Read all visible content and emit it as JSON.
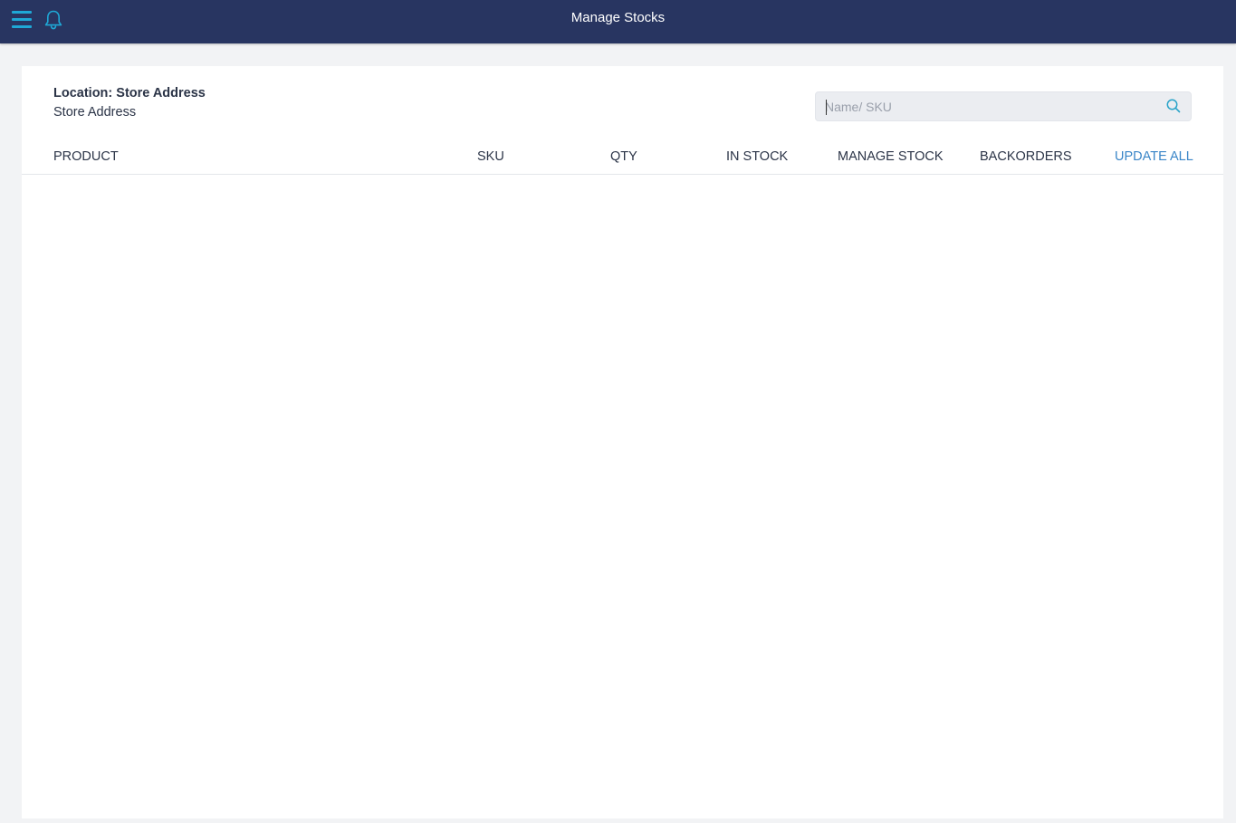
{
  "header": {
    "title": "Manage Stocks",
    "menu_icon": "hamburger-menu-icon",
    "notification_icon": "bell-icon",
    "background_color": "#283561",
    "icon_color": "#1fa8d6"
  },
  "location": {
    "title": "Location: Store Address",
    "subtitle": "Store Address"
  },
  "search": {
    "placeholder": "Name/ SKU",
    "value": "",
    "icon": "search-icon",
    "icon_color": "#2aa4c9"
  },
  "table": {
    "columns": [
      "PRODUCT",
      "SKU",
      "QTY",
      "IN STOCK",
      "MANAGE STOCK",
      "BACKORDERS"
    ],
    "update_all_label": "UPDATE ALL",
    "update_all_color": "#3a86c8",
    "rows": []
  }
}
